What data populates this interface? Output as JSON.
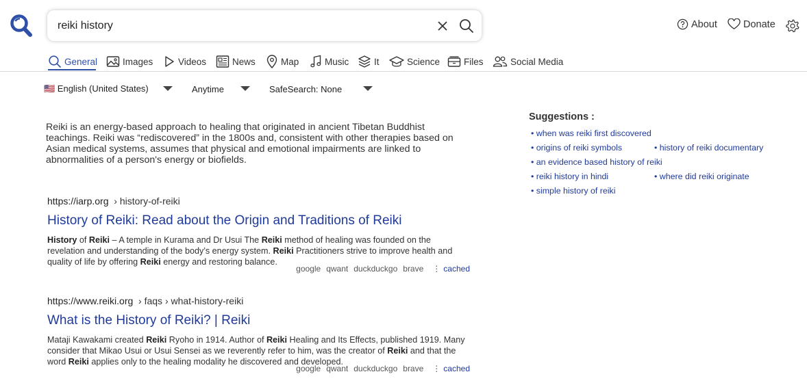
{
  "search": {
    "query": "reiki history"
  },
  "top_links": {
    "about": "About",
    "donate": "Donate"
  },
  "tabs": [
    {
      "label": "General",
      "icon": "search-icon"
    },
    {
      "label": "Images",
      "icon": "image-icon"
    },
    {
      "label": "Videos",
      "icon": "play-icon"
    },
    {
      "label": "News",
      "icon": "newspaper-icon"
    },
    {
      "label": "Map",
      "icon": "map-pin-icon"
    },
    {
      "label": "Music",
      "icon": "music-icon"
    },
    {
      "label": "It",
      "icon": "layers-icon"
    },
    {
      "label": "Science",
      "icon": "graduation-cap-icon"
    },
    {
      "label": "Files",
      "icon": "files-icon"
    },
    {
      "label": "Social Media",
      "icon": "people-icon"
    }
  ],
  "filters": {
    "language": "🇺🇸 English (United States)",
    "time": "Anytime",
    "safesearch": "SafeSearch: None"
  },
  "answer": "Reiki is an energy-based approach to healing that originated in ancient Tibetan Buddhist teachings. Reiki was “rediscovered” in the 1800s and, consistent with other therapies based on Asian medical systems, assumes that physical and emotional impairments are linked to abnormalities of a person's energy or biofields.",
  "results": [
    {
      "url": "https://iarp.org",
      "path": "› history-of-reiki",
      "title": "History of Reiki: Read about the Origin and Traditions of Reiki",
      "snippet_html": "<b>History</b> of <b>Reiki</b> – A temple in Kurama and Dr Usui The <b>Reiki</b> method of healing was founded on the revelation and understanding of the body’s energy system. <b>Reiki</b> Practitioners strive to improve health and quality of life by offering <b>Reiki</b> energy and restoring balance."
    },
    {
      "url": "https://www.reiki.org",
      "path": "› faqs › what-history-reiki",
      "title": "What is the History of Reiki? | Reiki",
      "snippet_html": "Mataji Kawakami created <b>Reiki</b> Ryoho in 1914. Author of <b>Reiki</b> Healing and Its Effects, published 1919. Many consider that Mikao Usui or Usui Sensei as we reverently refer to him, was the creator of <b>Reiki</b> and that the word <b>Reiki</b> applies only to the healing modality he discovered and developed."
    }
  ],
  "engines": [
    "google",
    "qwant",
    "duckduckgo",
    "brave"
  ],
  "cached_label": "cached",
  "suggestions": {
    "title": "Suggestions :",
    "items": [
      "• when was reiki first discovered",
      "• origins of reiki symbols",
      "• history of reiki documentary",
      "• an evidence based history of reiki",
      "• reiki history in hindi",
      "• where did reiki originate",
      "• simple history of reiki"
    ]
  },
  "colors": {
    "accent": "#3050a8",
    "link": "#203a9a"
  }
}
